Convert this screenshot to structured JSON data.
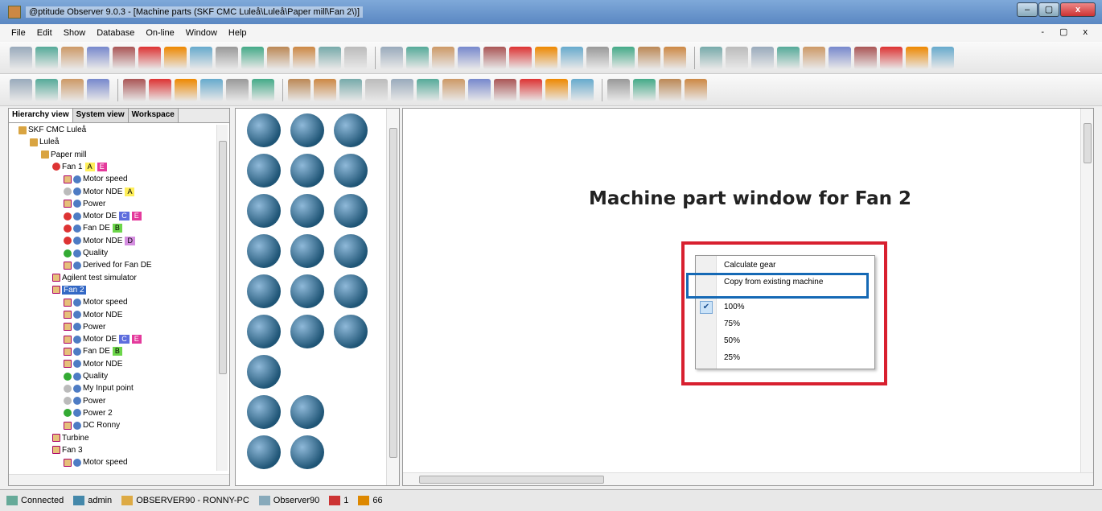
{
  "window": {
    "title": "@ptitude Observer 9.0.3 - [Machine parts (SKF CMC Luleå\\Luleå\\Paper mill\\Fan 2\\)]"
  },
  "menu": [
    "File",
    "Edit",
    "Show",
    "Database",
    "On-line",
    "Window",
    "Help"
  ],
  "mdi_controls": "- ▢ x",
  "tabs": [
    "Hierarchy view",
    "System view",
    "Workspace"
  ],
  "tree": [
    {
      "label": "SKF CMC Luleå",
      "icon": "gold",
      "indent": 0
    },
    {
      "label": "Luleå",
      "icon": "gold",
      "indent": 1
    },
    {
      "label": "Paper mill",
      "icon": "gold",
      "indent": 2
    },
    {
      "label": "Fan 1",
      "icon": "red",
      "indent": 3,
      "badges": [
        "A",
        "E"
      ]
    },
    {
      "label": "Motor speed",
      "icon": "sq",
      "indent": 4
    },
    {
      "label": "Motor NDE",
      "icon": "grey",
      "indent": 4,
      "badges": [
        "A"
      ]
    },
    {
      "label": "Power",
      "icon": "sq",
      "indent": 4
    },
    {
      "label": "Motor DE",
      "icon": "red",
      "indent": 4,
      "badges": [
        "C",
        "E"
      ]
    },
    {
      "label": "Fan DE",
      "icon": "red",
      "indent": 4,
      "badges": [
        "B"
      ]
    },
    {
      "label": "Motor NDE",
      "icon": "red",
      "indent": 4,
      "badges": [
        "D"
      ]
    },
    {
      "label": "Quality",
      "icon": "green",
      "indent": 4
    },
    {
      "label": "Derived for Fan DE",
      "icon": "sq",
      "indent": 4
    },
    {
      "label": "Agilent test simulator",
      "icon": "sq",
      "indent": 3
    },
    {
      "label": "Fan 2",
      "icon": "sq",
      "indent": 3,
      "selected": true
    },
    {
      "label": "Motor speed",
      "icon": "sq",
      "indent": 4
    },
    {
      "label": "Motor NDE",
      "icon": "sq",
      "indent": 4
    },
    {
      "label": "Power",
      "icon": "sq",
      "indent": 4
    },
    {
      "label": "Motor DE",
      "icon": "sq",
      "indent": 4,
      "badges": [
        "C",
        "E"
      ]
    },
    {
      "label": "Fan DE",
      "icon": "sq",
      "indent": 4,
      "badges": [
        "B"
      ]
    },
    {
      "label": "Motor NDE",
      "icon": "sq",
      "indent": 4
    },
    {
      "label": "Quality",
      "icon": "green",
      "indent": 4
    },
    {
      "label": "My Input point",
      "icon": "grey",
      "indent": 4
    },
    {
      "label": "Power",
      "icon": "grey",
      "indent": 4
    },
    {
      "label": "Power 2",
      "icon": "green",
      "indent": 4
    },
    {
      "label": "DC Ronny",
      "icon": "sq",
      "indent": 4
    },
    {
      "label": "Turbine",
      "icon": "sq",
      "indent": 3
    },
    {
      "label": "Fan 3",
      "icon": "sq",
      "indent": 3
    },
    {
      "label": "Motor speed",
      "icon": "sq",
      "indent": 4
    }
  ],
  "main": {
    "heading": "Machine part window for Fan 2"
  },
  "context_menu": {
    "items": [
      "Calculate gear",
      "Copy from existing machine",
      "100%",
      "75%",
      "50%",
      "25%"
    ],
    "checked": "100%"
  },
  "status": {
    "connection": "Connected",
    "user": "admin",
    "server": "OBSERVER90 - RONNY-PC",
    "database": "Observer90",
    "alarm_count": "1",
    "count_2": "66"
  },
  "colors": {
    "highlight_red": "#d8202f",
    "highlight_blue": "#1569b5",
    "selection": "#3468c5"
  }
}
